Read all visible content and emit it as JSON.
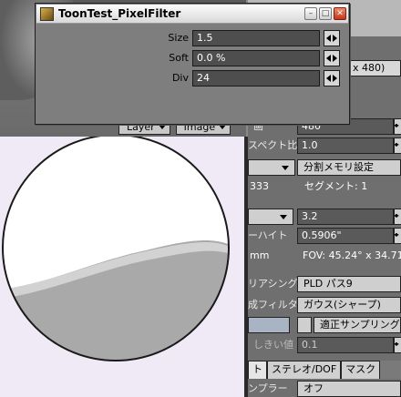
{
  "viewport": {
    "layer_label": "Layer",
    "image_label": "Image"
  },
  "panel": {
    "size_suffix": "x 480)",
    "aspect_value": "480",
    "aspect_label": "画",
    "pixel_aspect_label": "スペクト比",
    "pixel_aspect_value": "1.0",
    "segment_memory_button": "分割メモリ設定",
    "num_333": "333",
    "segment_label": "セグメント: 1",
    "zoom_value": "3.2",
    "film_height_label": "ーハイト",
    "film_height_value": "0.5906\"",
    "mm_label": "mm",
    "fov_label": "FOV: 45.24° x 34.71°",
    "antialias_label": "アンチエイリアシング",
    "antialias_short": "リアシング",
    "antialias_value": "PLD パス9",
    "recon_filter_label": "成フィルタ",
    "recon_filter_value": "ガウス(シャープ)",
    "adaptive_label": "適正サンプリング",
    "threshold_label": "しきい値",
    "threshold_value": "0.1",
    "tabs": [
      "ト",
      "ステレオ/DOF",
      "マスク"
    ],
    "sampler_label": "ンプラー",
    "sampler_value": "オフ"
  },
  "window": {
    "title": "ToonTest_PixelFilter",
    "minimize_icon": "minimize-icon",
    "maximize_icon": "maximize-icon",
    "close_icon": "close-icon",
    "fields": [
      {
        "label": "Size",
        "value": "1.5"
      },
      {
        "label": "Soft",
        "value": "0.0 %"
      },
      {
        "label": "Div",
        "value": "24"
      }
    ]
  },
  "colors": {
    "render_background": "#efeaf5",
    "sphere_light": "#ffffff",
    "sphere_shadow": "#a9a9a9",
    "outline": "#1a1a1a"
  }
}
